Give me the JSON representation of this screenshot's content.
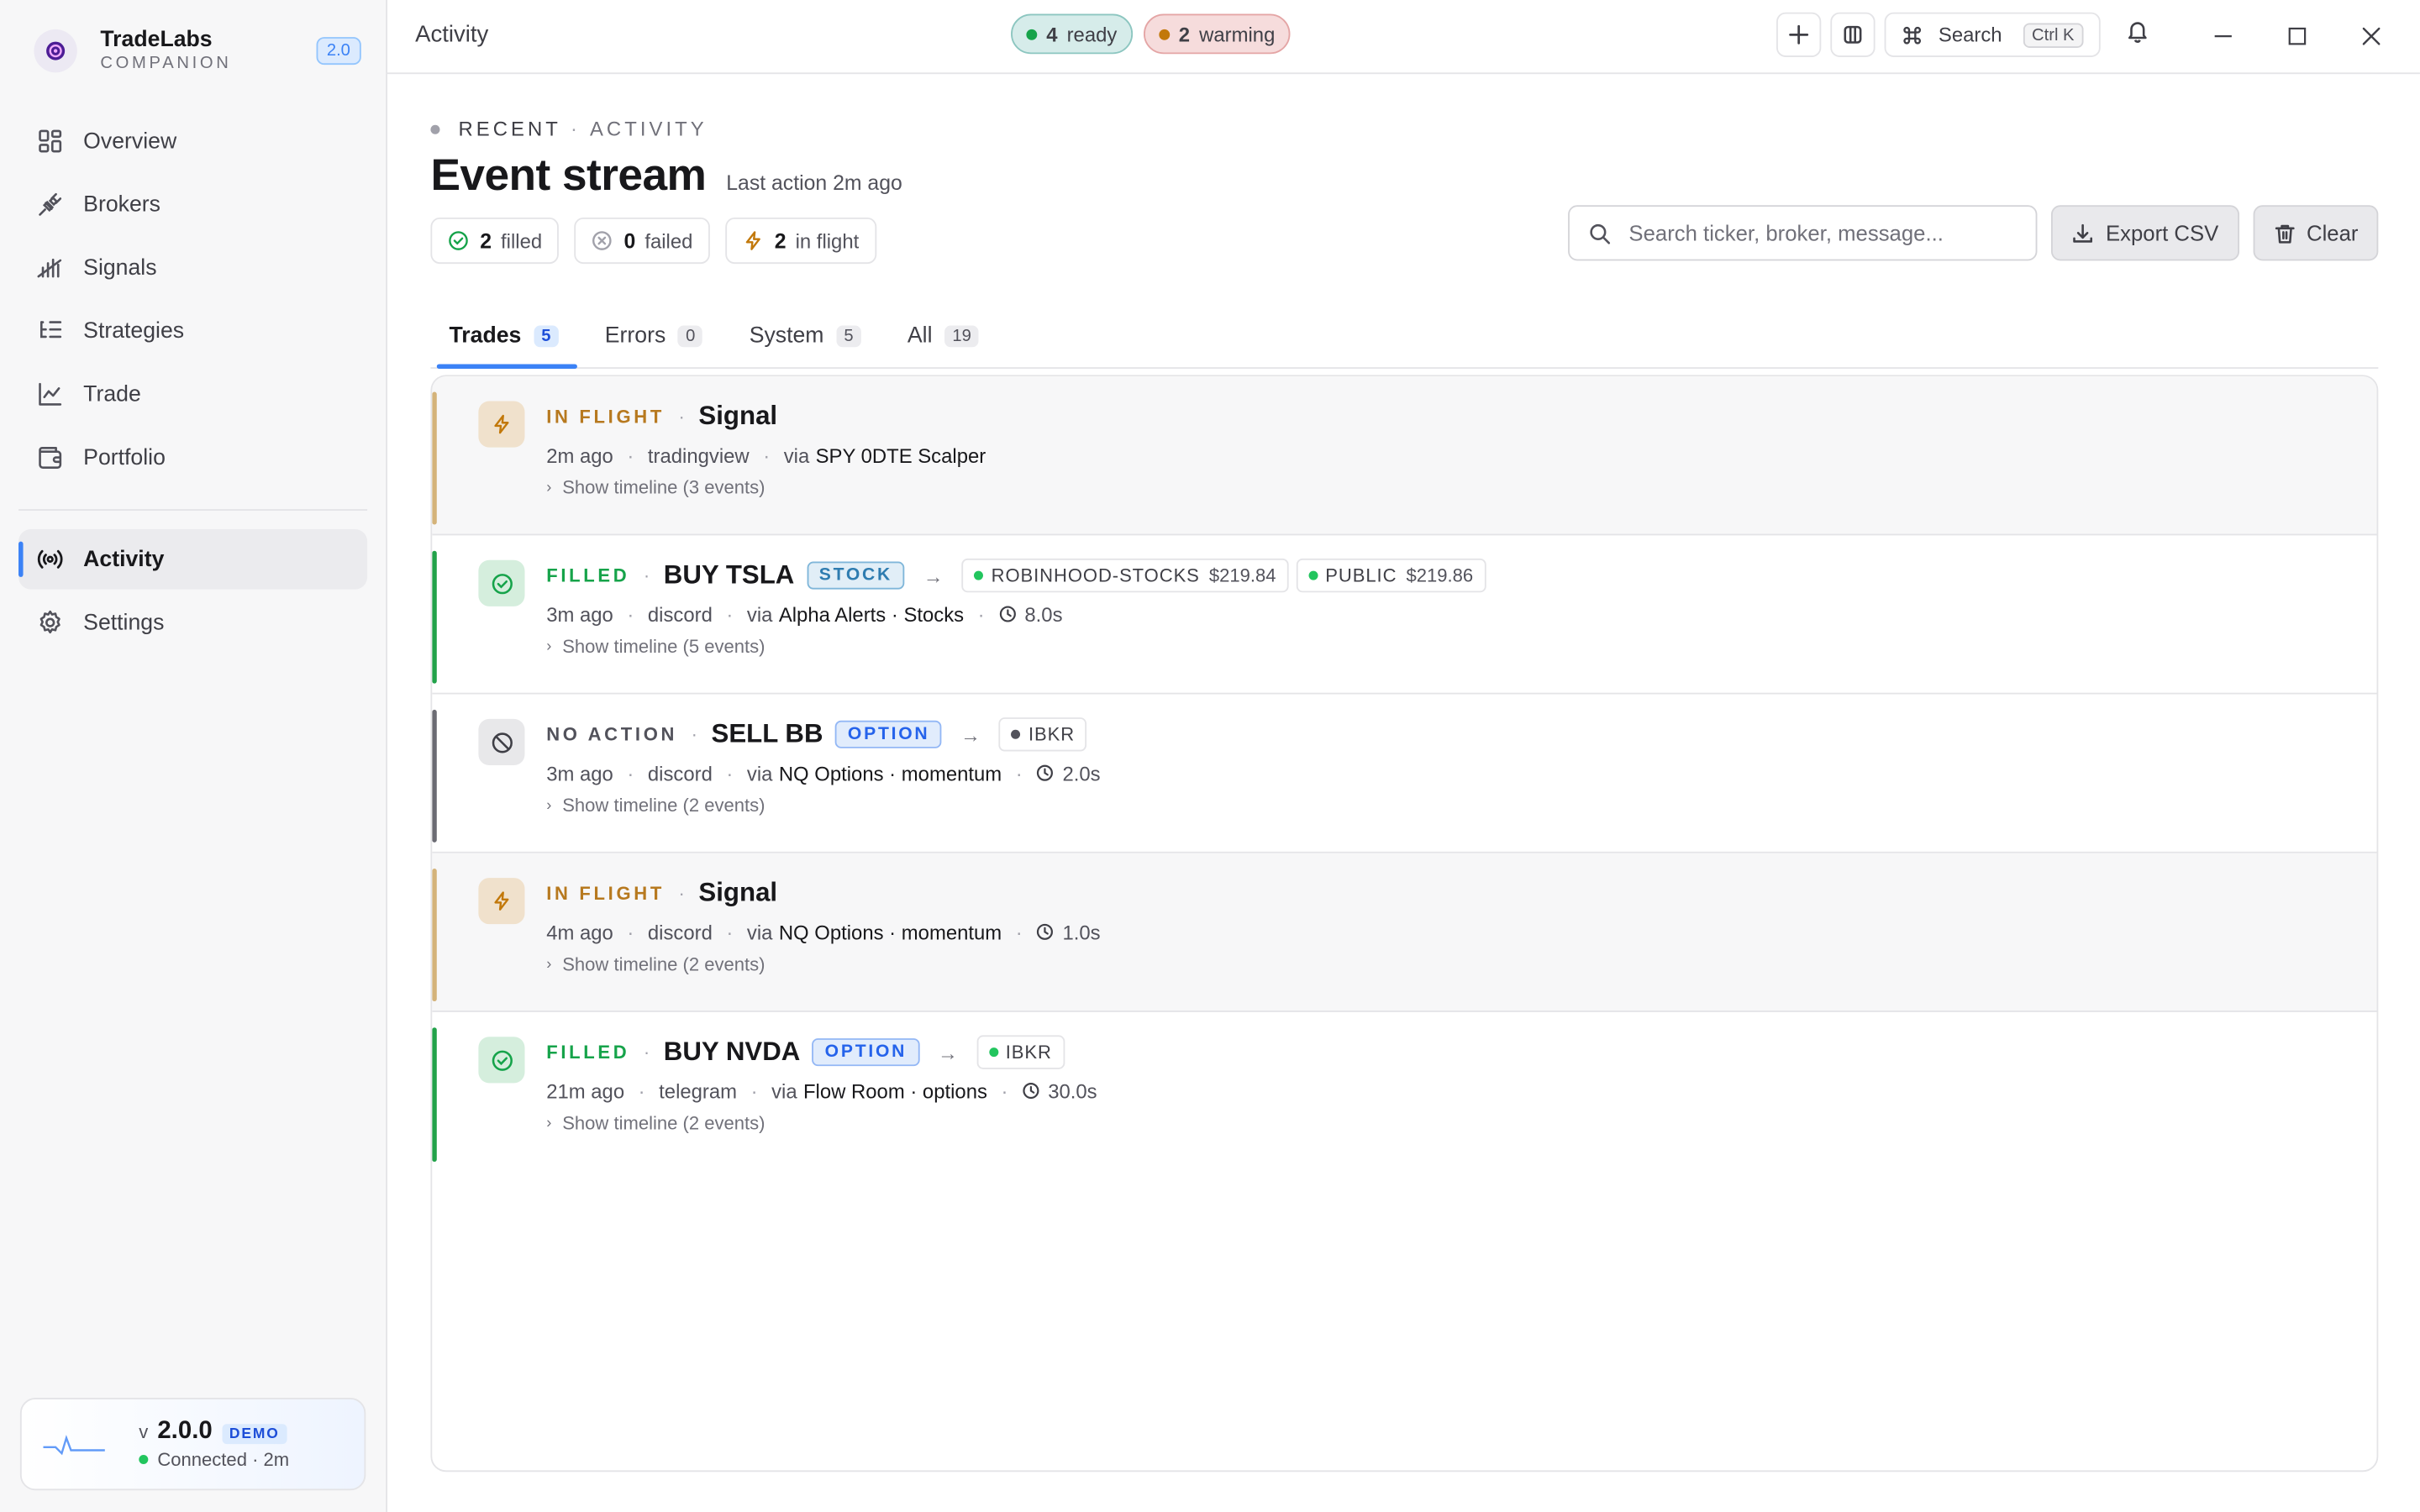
{
  "app": {
    "name": "TradeLabs",
    "subtitle": "COMPANION",
    "version_badge": "2.0"
  },
  "sidebar": {
    "items": [
      {
        "label": "Overview",
        "icon": "grid-icon"
      },
      {
        "label": "Brokers",
        "icon": "plug-icon"
      },
      {
        "label": "Signals",
        "icon": "signal-bars-icon"
      },
      {
        "label": "Strategies",
        "icon": "list-tree-icon"
      },
      {
        "label": "Trade",
        "icon": "line-chart-icon"
      },
      {
        "label": "Portfolio",
        "icon": "wallet-icon"
      }
    ],
    "bottom_items": [
      {
        "label": "Activity",
        "icon": "broadcast-icon",
        "active": true
      },
      {
        "label": "Settings",
        "icon": "gear-icon"
      }
    ],
    "version_card": {
      "prefix": "v",
      "version": "2.0.0",
      "badge": "DEMO",
      "status": "Connected · 2m"
    }
  },
  "topbar": {
    "title": "Activity",
    "ready_count": "4",
    "ready_label": "ready",
    "warming_count": "2",
    "warming_label": "warming",
    "search_label": "Search",
    "search_shortcut": "Ctrl K"
  },
  "header": {
    "eyebrow_1": "RECENT",
    "eyebrow_2": "ACTIVITY",
    "title": "Event stream",
    "last_action": "Last action 2m ago",
    "counts": [
      {
        "n": "2",
        "label": "filled"
      },
      {
        "n": "0",
        "label": "failed"
      },
      {
        "n": "2",
        "label": "in flight"
      }
    ],
    "search_placeholder": "Search ticker, broker, message...",
    "export_label": "Export CSV",
    "clear_label": "Clear"
  },
  "tabs": [
    {
      "label": "Trades",
      "count": "5",
      "active": true
    },
    {
      "label": "Errors",
      "count": "0"
    },
    {
      "label": "System",
      "count": "5"
    },
    {
      "label": "All",
      "count": "19"
    }
  ],
  "events": [
    {
      "status": "IN FLIGHT",
      "title": "Signal",
      "time": "2m ago",
      "source": "tradingview",
      "via": "via",
      "via_name": "SPY 0DTE Scalper",
      "timeline": "Show timeline (3 events)"
    },
    {
      "status": "FILLED",
      "title": "BUY TSLA",
      "type": "STOCK",
      "brokers": [
        {
          "name": "ROBINHOOD-STOCKS",
          "price": "$219.84"
        },
        {
          "name": "PUBLIC",
          "price": "$219.86"
        }
      ],
      "time": "3m ago",
      "source": "discord",
      "via": "via",
      "via_name": "Alpha Alerts · Stocks",
      "duration": "8.0s",
      "timeline": "Show timeline (5 events)"
    },
    {
      "status": "NO ACTION",
      "title": "SELL BB",
      "type": "OPTION",
      "brokers": [
        {
          "name": "IBKR"
        }
      ],
      "time": "3m ago",
      "source": "discord",
      "via": "via",
      "via_name": "NQ Options · momentum",
      "duration": "2.0s",
      "timeline": "Show timeline (2 events)"
    },
    {
      "status": "IN FLIGHT",
      "title": "Signal",
      "time": "4m ago",
      "source": "discord",
      "via": "via",
      "via_name": "NQ Options · momentum",
      "duration": "1.0s",
      "timeline": "Show timeline (2 events)"
    },
    {
      "status": "FILLED",
      "title": "BUY NVDA",
      "type": "OPTION",
      "brokers": [
        {
          "name": "IBKR"
        }
      ],
      "time": "21m ago",
      "source": "telegram",
      "via": "via",
      "via_name": "Flow Room · options",
      "duration": "30.0s",
      "timeline": "Show timeline (2 events)"
    }
  ],
  "colors": {
    "accent": "#3b82f6",
    "filled": "#16a34a",
    "in_flight": "#b7791f",
    "no_action": "#52525b"
  }
}
